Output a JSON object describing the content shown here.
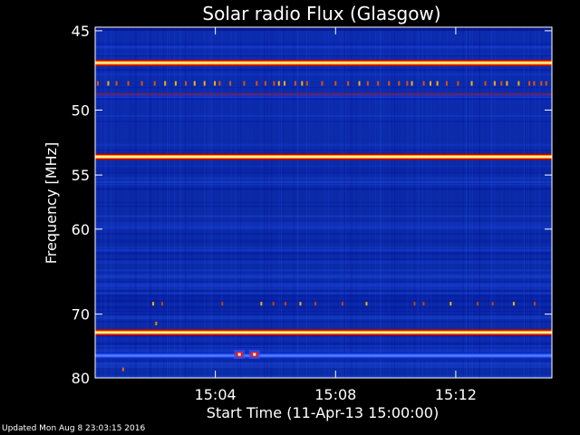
{
  "chart_data": {
    "type": "heatmap",
    "title": "Solar radio Flux (Glasgow)",
    "xlabel": "Start Time (11-Apr-13 15:00:00)",
    "ylabel": "Frequency [MHz]",
    "x_range_minutes": [
      0,
      15.2
    ],
    "x_ticks": [
      {
        "minute": 4,
        "label": "15:04"
      },
      {
        "minute": 8,
        "label": "15:08"
      },
      {
        "minute": 12,
        "label": "15:12"
      }
    ],
    "y_ticks": [
      {
        "value": 45,
        "label": "45"
      },
      {
        "value": 50,
        "label": "50"
      },
      {
        "value": 55,
        "label": "55"
      },
      {
        "value": 60,
        "label": "60"
      },
      {
        "value": 70,
        "label": "70"
      },
      {
        "value": 80,
        "label": "80"
      }
    ],
    "y_range_MHz": [
      44.8,
      80.0
    ],
    "y_scale": "reciprocal",
    "colormap": [
      "#000000",
      "#001e8c",
      "#0a32c8",
      "#5050e6",
      "#c81e1e",
      "#ff6400",
      "#ffc800",
      "#ffffc8"
    ],
    "bright_bands_MHz": [
      {
        "freq": 46.9,
        "intensity": 0.9
      },
      {
        "freq": 53.5,
        "intensity": 1.0
      },
      {
        "freq": 72.6,
        "intensity": 1.0
      },
      {
        "freq": 76.2,
        "intensity": 0.45
      }
    ],
    "burst_events": [
      {
        "minute": 4.8,
        "freq": 76.0,
        "intensity": 0.85
      },
      {
        "minute": 5.3,
        "freq": 76.0,
        "intensity": 0.75
      }
    ]
  },
  "footer": {
    "updated": "Updated Mon Aug  8 23:03:15 2016"
  }
}
